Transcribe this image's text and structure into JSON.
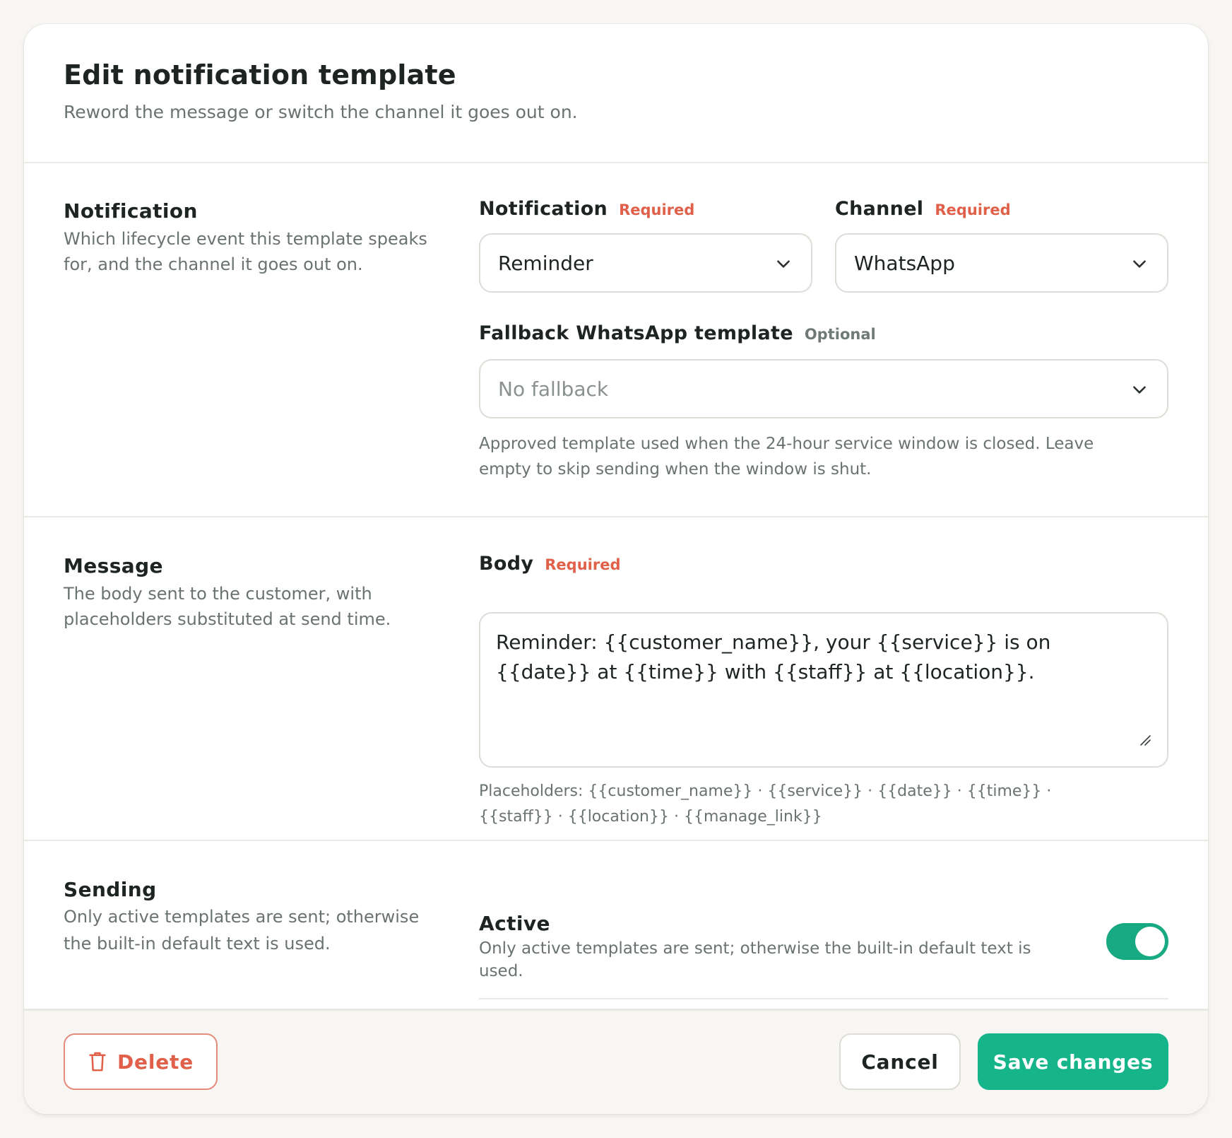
{
  "modal": {
    "title": "Edit notification template",
    "subtitle": "Reword the message or switch the channel it goes out on."
  },
  "sections": {
    "notification": {
      "title": "Notification",
      "description": "Which lifecycle event this template speaks for, and the channel it goes out on.",
      "notification_field": {
        "label": "Notification",
        "tag": "Required",
        "value": "Reminder"
      },
      "channel_field": {
        "label": "Channel",
        "tag": "Required",
        "value": "WhatsApp"
      },
      "fallback_field": {
        "label": "Fallback WhatsApp template",
        "tag": "Optional",
        "placeholder": "No fallback",
        "help": "Approved template used when the 24-hour service window is closed. Leave empty to skip sending when the window is shut."
      }
    },
    "message": {
      "title": "Message",
      "description": "The body sent to the customer, with placeholders substituted at send time.",
      "body_field": {
        "label": "Body",
        "tag": "Required",
        "value": "Reminder: {{customer_name}}, your {{service}} is on {{date}} at {{time}} with {{staff}} at {{location}}.",
        "help": "Placeholders: {{customer_name}} · {{service}} · {{date}} · {{time}} · {{staff}} · {{location}} · {{manage_link}}"
      }
    },
    "sending": {
      "title": "Sending",
      "description": "Only active templates are sent; otherwise the built-in default text is used.",
      "active_toggle": {
        "label": "Active",
        "description": "Only active templates are sent; otherwise the built-in default text is used.",
        "on": true
      }
    }
  },
  "footer": {
    "delete_label": "Delete",
    "cancel_label": "Cancel",
    "save_label": "Save changes"
  },
  "icons": {
    "select_chevron": "chevron-down-icon",
    "delete": "trash-icon",
    "resize": "resize-grip-icon"
  },
  "colors": {
    "accent": "#16b48a",
    "danger": "#e0604a",
    "background": "#f8f6f2"
  }
}
